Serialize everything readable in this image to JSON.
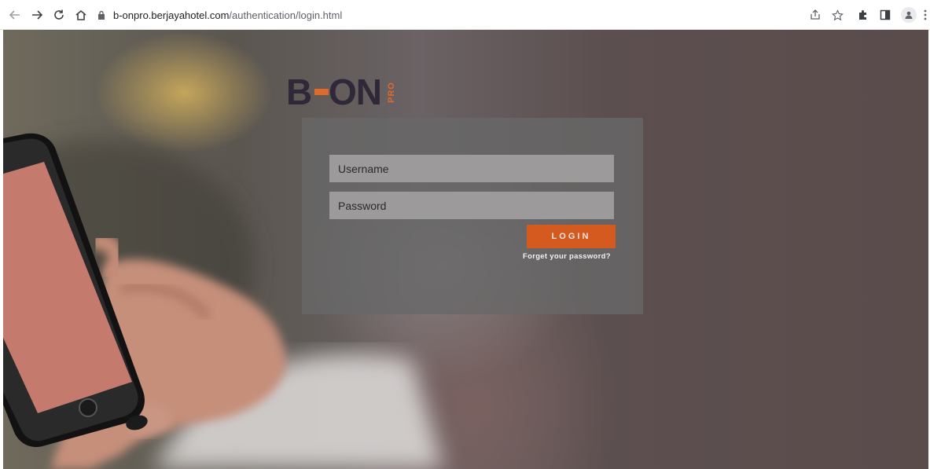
{
  "browser": {
    "url_host": "b-onpro.berjayahotel.com",
    "url_path": "/authentication/login.html",
    "icons": [
      "back-icon",
      "forward-icon",
      "reload-icon",
      "home-icon",
      "lock-icon",
      "share-icon",
      "star-icon",
      "extensions-icon",
      "side-panel-icon",
      "profile-icon",
      "menu-icon"
    ]
  },
  "logo": {
    "letter_b": "B",
    "letters_on": "ON",
    "suffix": "PRO",
    "colors": {
      "dark": "#2e2838",
      "accent": "#e06a2c"
    }
  },
  "login": {
    "username_placeholder": "Username",
    "password_placeholder": "Password",
    "button_label": "LOGIN",
    "forgot_link": "Forget your password?",
    "colors": {
      "button": "#d45a1f",
      "field": "#9c9a9b",
      "panel": "#686868"
    }
  }
}
